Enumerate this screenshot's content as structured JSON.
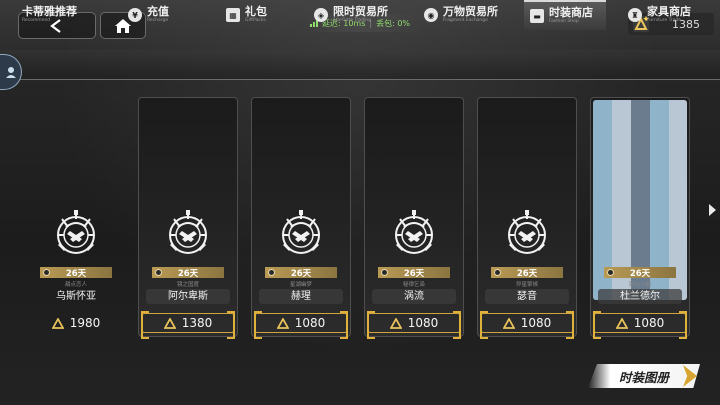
{
  "top": {
    "back_icon": "chevron-left-icon",
    "home_icon": "home-icon",
    "latency": "延迟: 10ms",
    "packet_loss": "丢包: 0%",
    "currency_icon": "gem-icon",
    "currency_value": "1385"
  },
  "tabs": [
    {
      "label": "卡蒂雅推荐",
      "sub": "Recommend",
      "icon": "badge-icon"
    },
    {
      "label": "充值",
      "sub": "Recharge",
      "icon": "yen-icon"
    },
    {
      "label": "礼包",
      "sub": "GiftPacks",
      "icon": "gift-icon"
    },
    {
      "label": "限时贸易所",
      "sub": "StarGate Trading",
      "icon": "trade-icon"
    },
    {
      "label": "万物贸易所",
      "sub": "Fragment Exchange",
      "icon": "exchange-icon"
    },
    {
      "label": "时装商店",
      "sub": "Fashion Shop",
      "icon": "fashion-icon"
    },
    {
      "label": "家具商店",
      "sub": "Furniture Trade",
      "icon": "furniture-icon"
    }
  ],
  "active_tab": 5,
  "cards": [
    {
      "days": "26天",
      "sub": "甜点恋人",
      "name": "乌斯怀亚",
      "price": "1980"
    },
    {
      "days": "26天",
      "sub": "镜之国度",
      "name": "阿尔卑斯",
      "price": "1380"
    },
    {
      "days": "26天",
      "sub": "星湖幽梦",
      "name": "赫瑆",
      "price": "1080"
    },
    {
      "days": "26天",
      "sub": "秘律乞枭",
      "name": "涡流",
      "price": "1080"
    },
    {
      "days": "26天",
      "sub": "异星擎候",
      "name": "瑟音",
      "price": "1080"
    },
    {
      "days": "26天",
      "sub": "趴心一刻",
      "name": "杜兰德尔",
      "price": "1080"
    }
  ],
  "catalog_button": "时装图册",
  "colors": {
    "accent_gold": "#d9a531",
    "price_frame": "#cfa43f",
    "latency_green": "#8fdc6c"
  }
}
